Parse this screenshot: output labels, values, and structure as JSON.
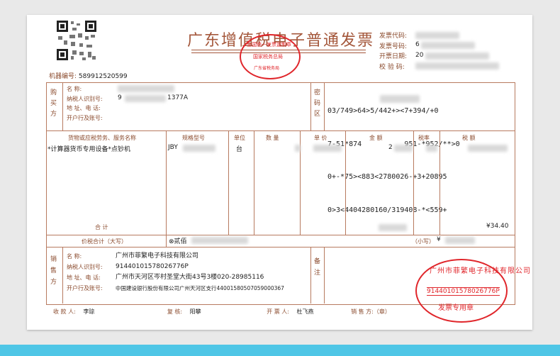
{
  "invoice": {
    "title": "广东增值税电子普通发票",
    "machine_no_label": "机器编号:",
    "machine_no": "589912520599",
    "meta_labels": [
      "发票代码:",
      "发票号码:",
      "开票日期:",
      "校 验 码:"
    ],
    "meta_partial_values": [
      "",
      "6",
      "20",
      ""
    ],
    "buyer": {
      "section_label": "购买方",
      "name_label": "名        称:",
      "taxid_label": "纳税人识别号:",
      "taxid_partial": "9",
      "taxid_suffix": "1377A",
      "address_label": "地 址、电 话:",
      "bank_label": "开户行及账号:"
    },
    "cipher": {
      "section_label": "密码区",
      "lines": [
        "03/749>64>5/442+><7+394/+0",
        "7-51*874          951-*952/**>0",
        "0+-*75><883<2780026-+3+20895",
        "0>3<4404280160/319408-*<559+"
      ]
    },
    "items_header": [
      "货物或应税劳务、服务名称",
      "规格型号",
      "单位",
      "数  量",
      "单  价",
      "金  额",
      "税率",
      "税  额"
    ],
    "items": [
      {
        "name": "*计算器货币专用设备*点钞机",
        "model_partial": "JBY",
        "unit": "台",
        "amount_partial": "2"
      }
    ],
    "total_label": "合        计",
    "total_tax": "¥34.40",
    "grand_total_label": "价税合计（大写）",
    "grand_total_prefix": "⊗贰佰",
    "grand_total_small_label": "（小写）",
    "grand_total_small_prefix": "¥",
    "seller": {
      "section_label": "销售方",
      "name_label": "名        称:",
      "name": "广州市菲繁电子科技有限公司",
      "taxid_label": "纳税人识别号:",
      "taxid": "91440101578026776P",
      "address_label": "地 址、电 话:",
      "address": "广州市天河区岑村圣堂大街43号3楼020-28985116",
      "bank_label": "开户行及账号:",
      "bank": "中国建设银行股份有限公司广州天河区支行44001580507059000367"
    },
    "remarks_label": "备注",
    "footer": {
      "payee_label": "收 款 人:",
      "payee": "李琼",
      "reviewer_label": "复 核:",
      "reviewer": "阳攀",
      "issuer_label": "开 票 人:",
      "issuer": "杜飞燕",
      "seller_label": "销 售 方:（章）"
    },
    "seal_top": {
      "line1": "全国统一发票监制章",
      "line2": "国家税务总局",
      "line3": "广东省税务局"
    },
    "seal_seller": {
      "ring": "广州市菲繁电子科技有限公司",
      "taxid": "91440101578026776P",
      "label": "发票专用章"
    }
  }
}
